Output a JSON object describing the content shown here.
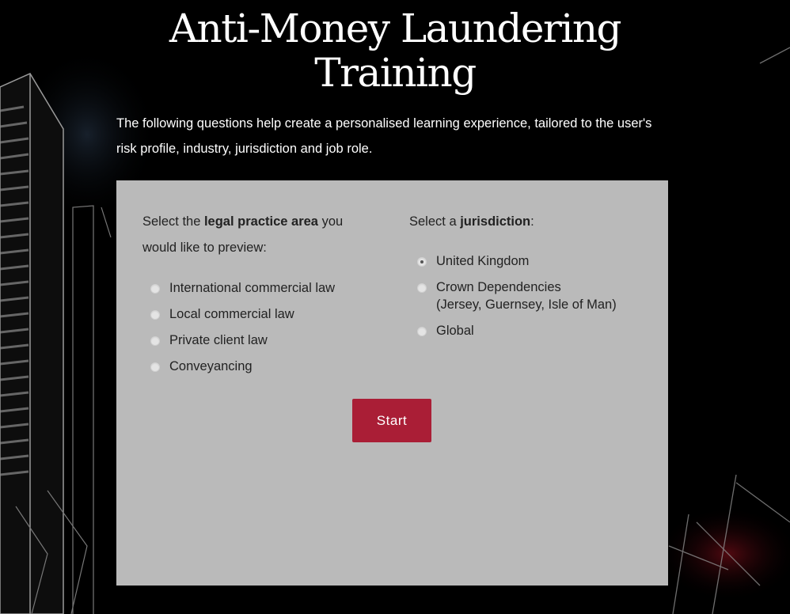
{
  "header": {
    "title_line1": "Anti-Money Laundering",
    "title_line2": "Training",
    "intro": "The following questions help create a personalised learning experience, tailored to the user's risk profile, industry, jurisdiction and job role."
  },
  "practice_area": {
    "prompt_prefix": "Select the ",
    "prompt_bold": "legal practice area",
    "prompt_suffix": " you would like to preview:",
    "options": [
      {
        "label": "International commercial law",
        "selected": false
      },
      {
        "label": "Local commercial law",
        "selected": false
      },
      {
        "label": "Private client law",
        "selected": false
      },
      {
        "label": "Conveyancing",
        "selected": false
      }
    ]
  },
  "jurisdiction": {
    "prompt_prefix": "Select a ",
    "prompt_bold": "jurisdiction",
    "prompt_suffix": ":",
    "options": [
      {
        "label": "United Kingdom",
        "sublabel": "",
        "selected": true
      },
      {
        "label": "Crown Dependencies",
        "sublabel": "(Jersey, Guernsey, Isle of Man)",
        "selected": false
      },
      {
        "label": "Global",
        "sublabel": "",
        "selected": false
      }
    ]
  },
  "actions": {
    "start_label": "Start"
  },
  "colors": {
    "accent": "#aa1e36",
    "panel": "#c8c8c8",
    "background": "#000000"
  }
}
